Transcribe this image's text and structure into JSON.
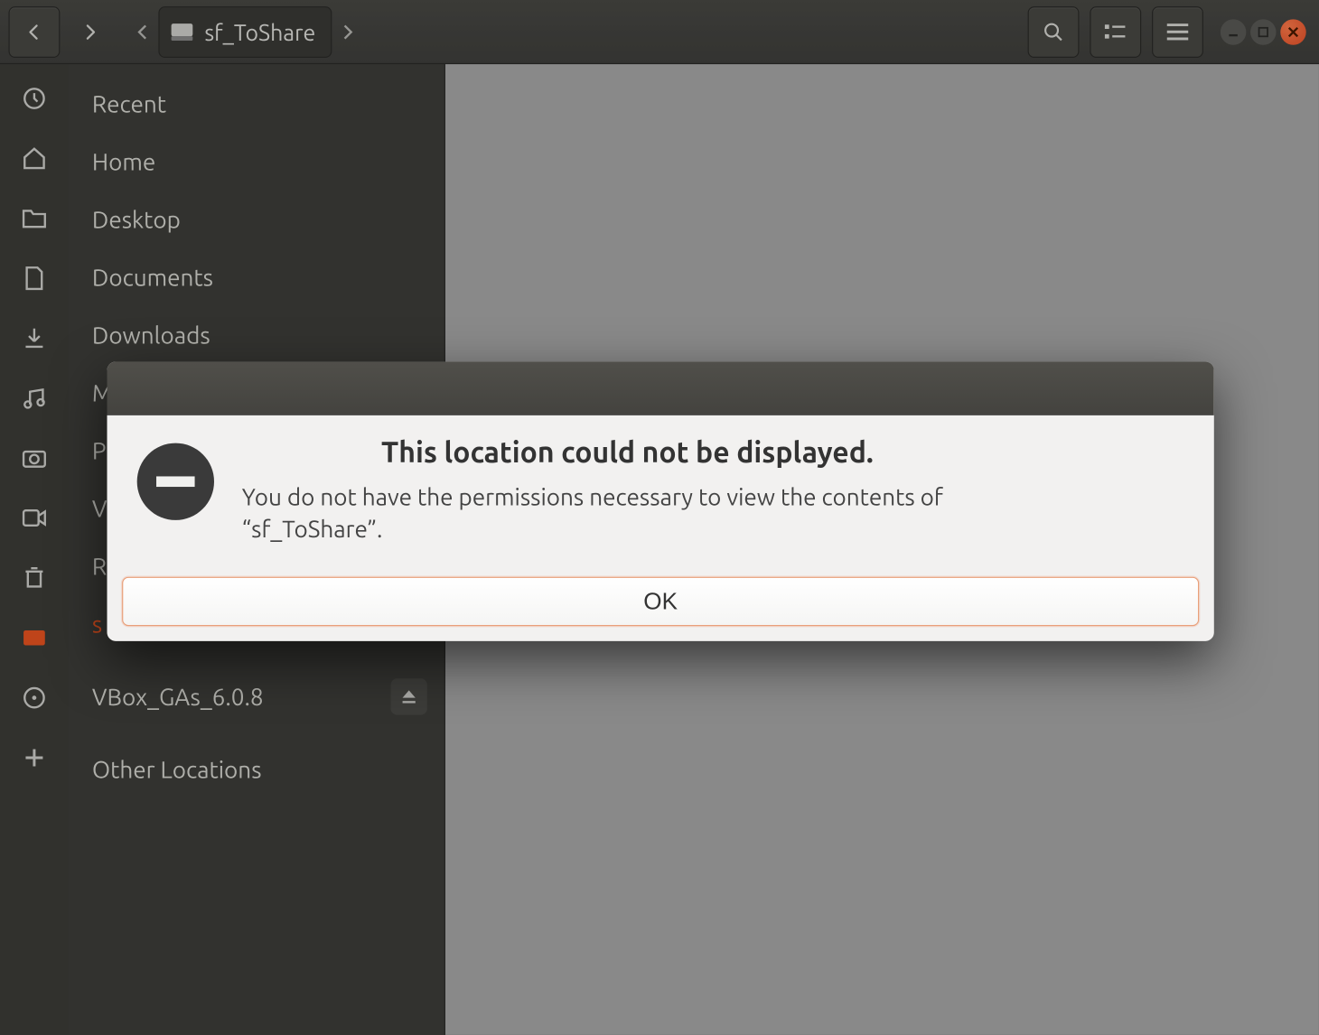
{
  "toolbar": {
    "path_segment_label": "sf_ToShare"
  },
  "sidebar": {
    "items": [
      {
        "label": "Recent"
      },
      {
        "label": "Home"
      },
      {
        "label": "Desktop"
      },
      {
        "label": "Documents"
      },
      {
        "label": "Downloads"
      },
      {
        "label": "M"
      },
      {
        "label": "P"
      },
      {
        "label": "V"
      },
      {
        "label": "R"
      },
      {
        "label": "s"
      },
      {
        "label": "VBox_GAs_6.0.8"
      },
      {
        "label": "Other Locations"
      }
    ]
  },
  "dialog": {
    "title": "This location could not be displayed.",
    "message": "You do not have the permissions necessary to view the contents of “sf_ToShare”.",
    "ok_label": "OK"
  }
}
